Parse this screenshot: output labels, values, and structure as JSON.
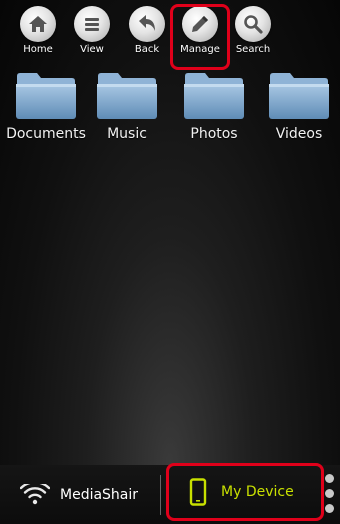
{
  "toolbar": {
    "buttons": [
      {
        "label": "Home",
        "icon": "home-icon"
      },
      {
        "label": "View",
        "icon": "list-icon"
      },
      {
        "label": "Back",
        "icon": "back-arrow-icon"
      },
      {
        "label": "Manage",
        "icon": "pencil-icon"
      },
      {
        "label": "Search",
        "icon": "magnifier-icon"
      }
    ],
    "highlighted": "Manage"
  },
  "folders": [
    {
      "name": "Documents",
      "icon": "folder-icon"
    },
    {
      "name": "Music",
      "icon": "folder-icon"
    },
    {
      "name": "Photos",
      "icon": "folder-icon"
    },
    {
      "name": "Videos",
      "icon": "folder-icon"
    }
  ],
  "bottom_tabs": {
    "mediashair": {
      "label": "MediaShair",
      "icon": "wifi-icon"
    },
    "my_device": {
      "label": "My Device",
      "icon": "phone-icon",
      "active": true
    }
  },
  "colors": {
    "highlight": "#e0001a",
    "active_tab_text": "#c8e000",
    "folder_blue": "#7aa3c9"
  }
}
